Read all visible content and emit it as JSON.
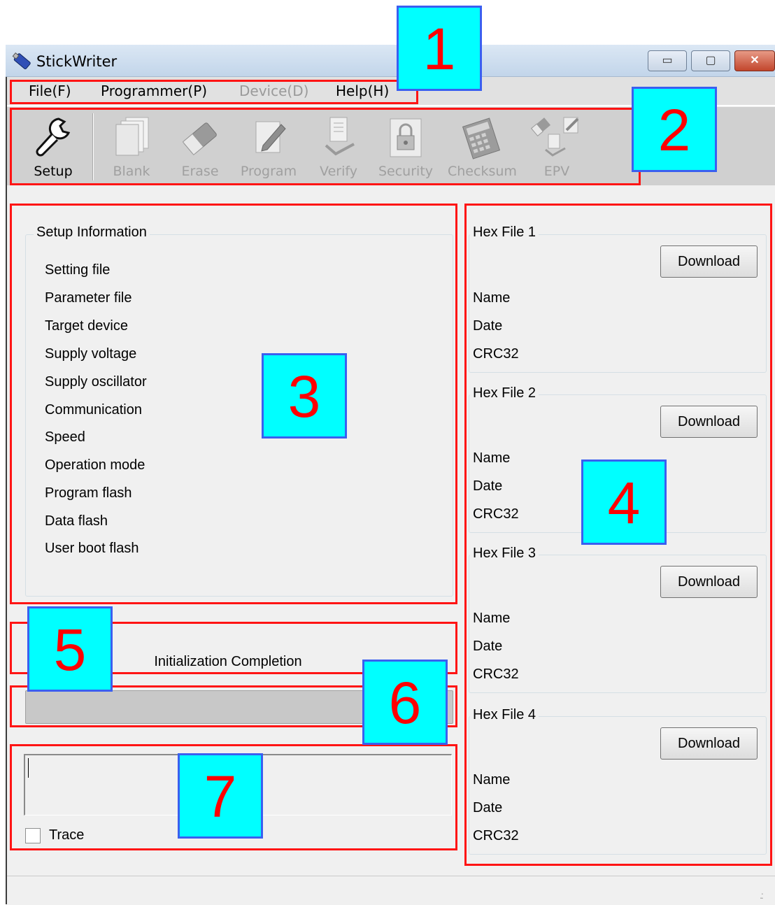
{
  "window": {
    "title": "StickWriter",
    "buttons": {
      "minimize": "▭",
      "maximize": "▢",
      "close": "✕"
    }
  },
  "menu": [
    {
      "label": "File(F)",
      "enabled": true
    },
    {
      "label": "Programmer(P)",
      "enabled": true
    },
    {
      "label": "Device(D)",
      "enabled": false
    },
    {
      "label": "Help(H)",
      "enabled": true
    }
  ],
  "toolbar": [
    {
      "label": "Setup",
      "icon": "wrench-icon",
      "enabled": true
    },
    {
      "label": "Blank",
      "icon": "blank-pages-icon",
      "enabled": false
    },
    {
      "label": "Erase",
      "icon": "eraser-icon",
      "enabled": false
    },
    {
      "label": "Program",
      "icon": "pencil-icon",
      "enabled": false
    },
    {
      "label": "Verify",
      "icon": "verify-document-icon",
      "enabled": false
    },
    {
      "label": "Security",
      "icon": "lock-icon",
      "enabled": false
    },
    {
      "label": "Checksum",
      "icon": "calculator-icon",
      "enabled": false
    },
    {
      "label": "EPV",
      "icon": "epv-icon",
      "enabled": false
    }
  ],
  "setup": {
    "title": "Setup Information",
    "items": [
      "Setting file",
      "Parameter file",
      "Target device",
      "Supply voltage",
      "Supply oscillator",
      "Communication",
      "Speed",
      "Operation mode",
      "Program flash",
      "Data flash",
      "User boot flash"
    ]
  },
  "hex_files": [
    {
      "title": "Hex File 1",
      "button": "Download",
      "fields": [
        "Name",
        "Date",
        "CRC32"
      ]
    },
    {
      "title": "Hex File 2",
      "button": "Download",
      "fields": [
        "Name",
        "Date",
        "CRC32"
      ]
    },
    {
      "title": "Hex File 3",
      "button": "Download",
      "fields": [
        "Name",
        "Date",
        "CRC32"
      ]
    },
    {
      "title": "Hex File 4",
      "button": "Download",
      "fields": [
        "Name",
        "Date",
        "CRC32"
      ]
    }
  ],
  "status": {
    "message": "Initialization Completion",
    "progress": 0
  },
  "log": {
    "value": "",
    "trace_label": "Trace",
    "trace_checked": false
  },
  "annotations": [
    "1",
    "2",
    "3",
    "4",
    "5",
    "6",
    "7"
  ],
  "colors": {
    "annotation_box": "#ff1414",
    "callout_fill": "#00ffff",
    "callout_text": "#ff0000",
    "callout_border": "#3a5ff0"
  }
}
